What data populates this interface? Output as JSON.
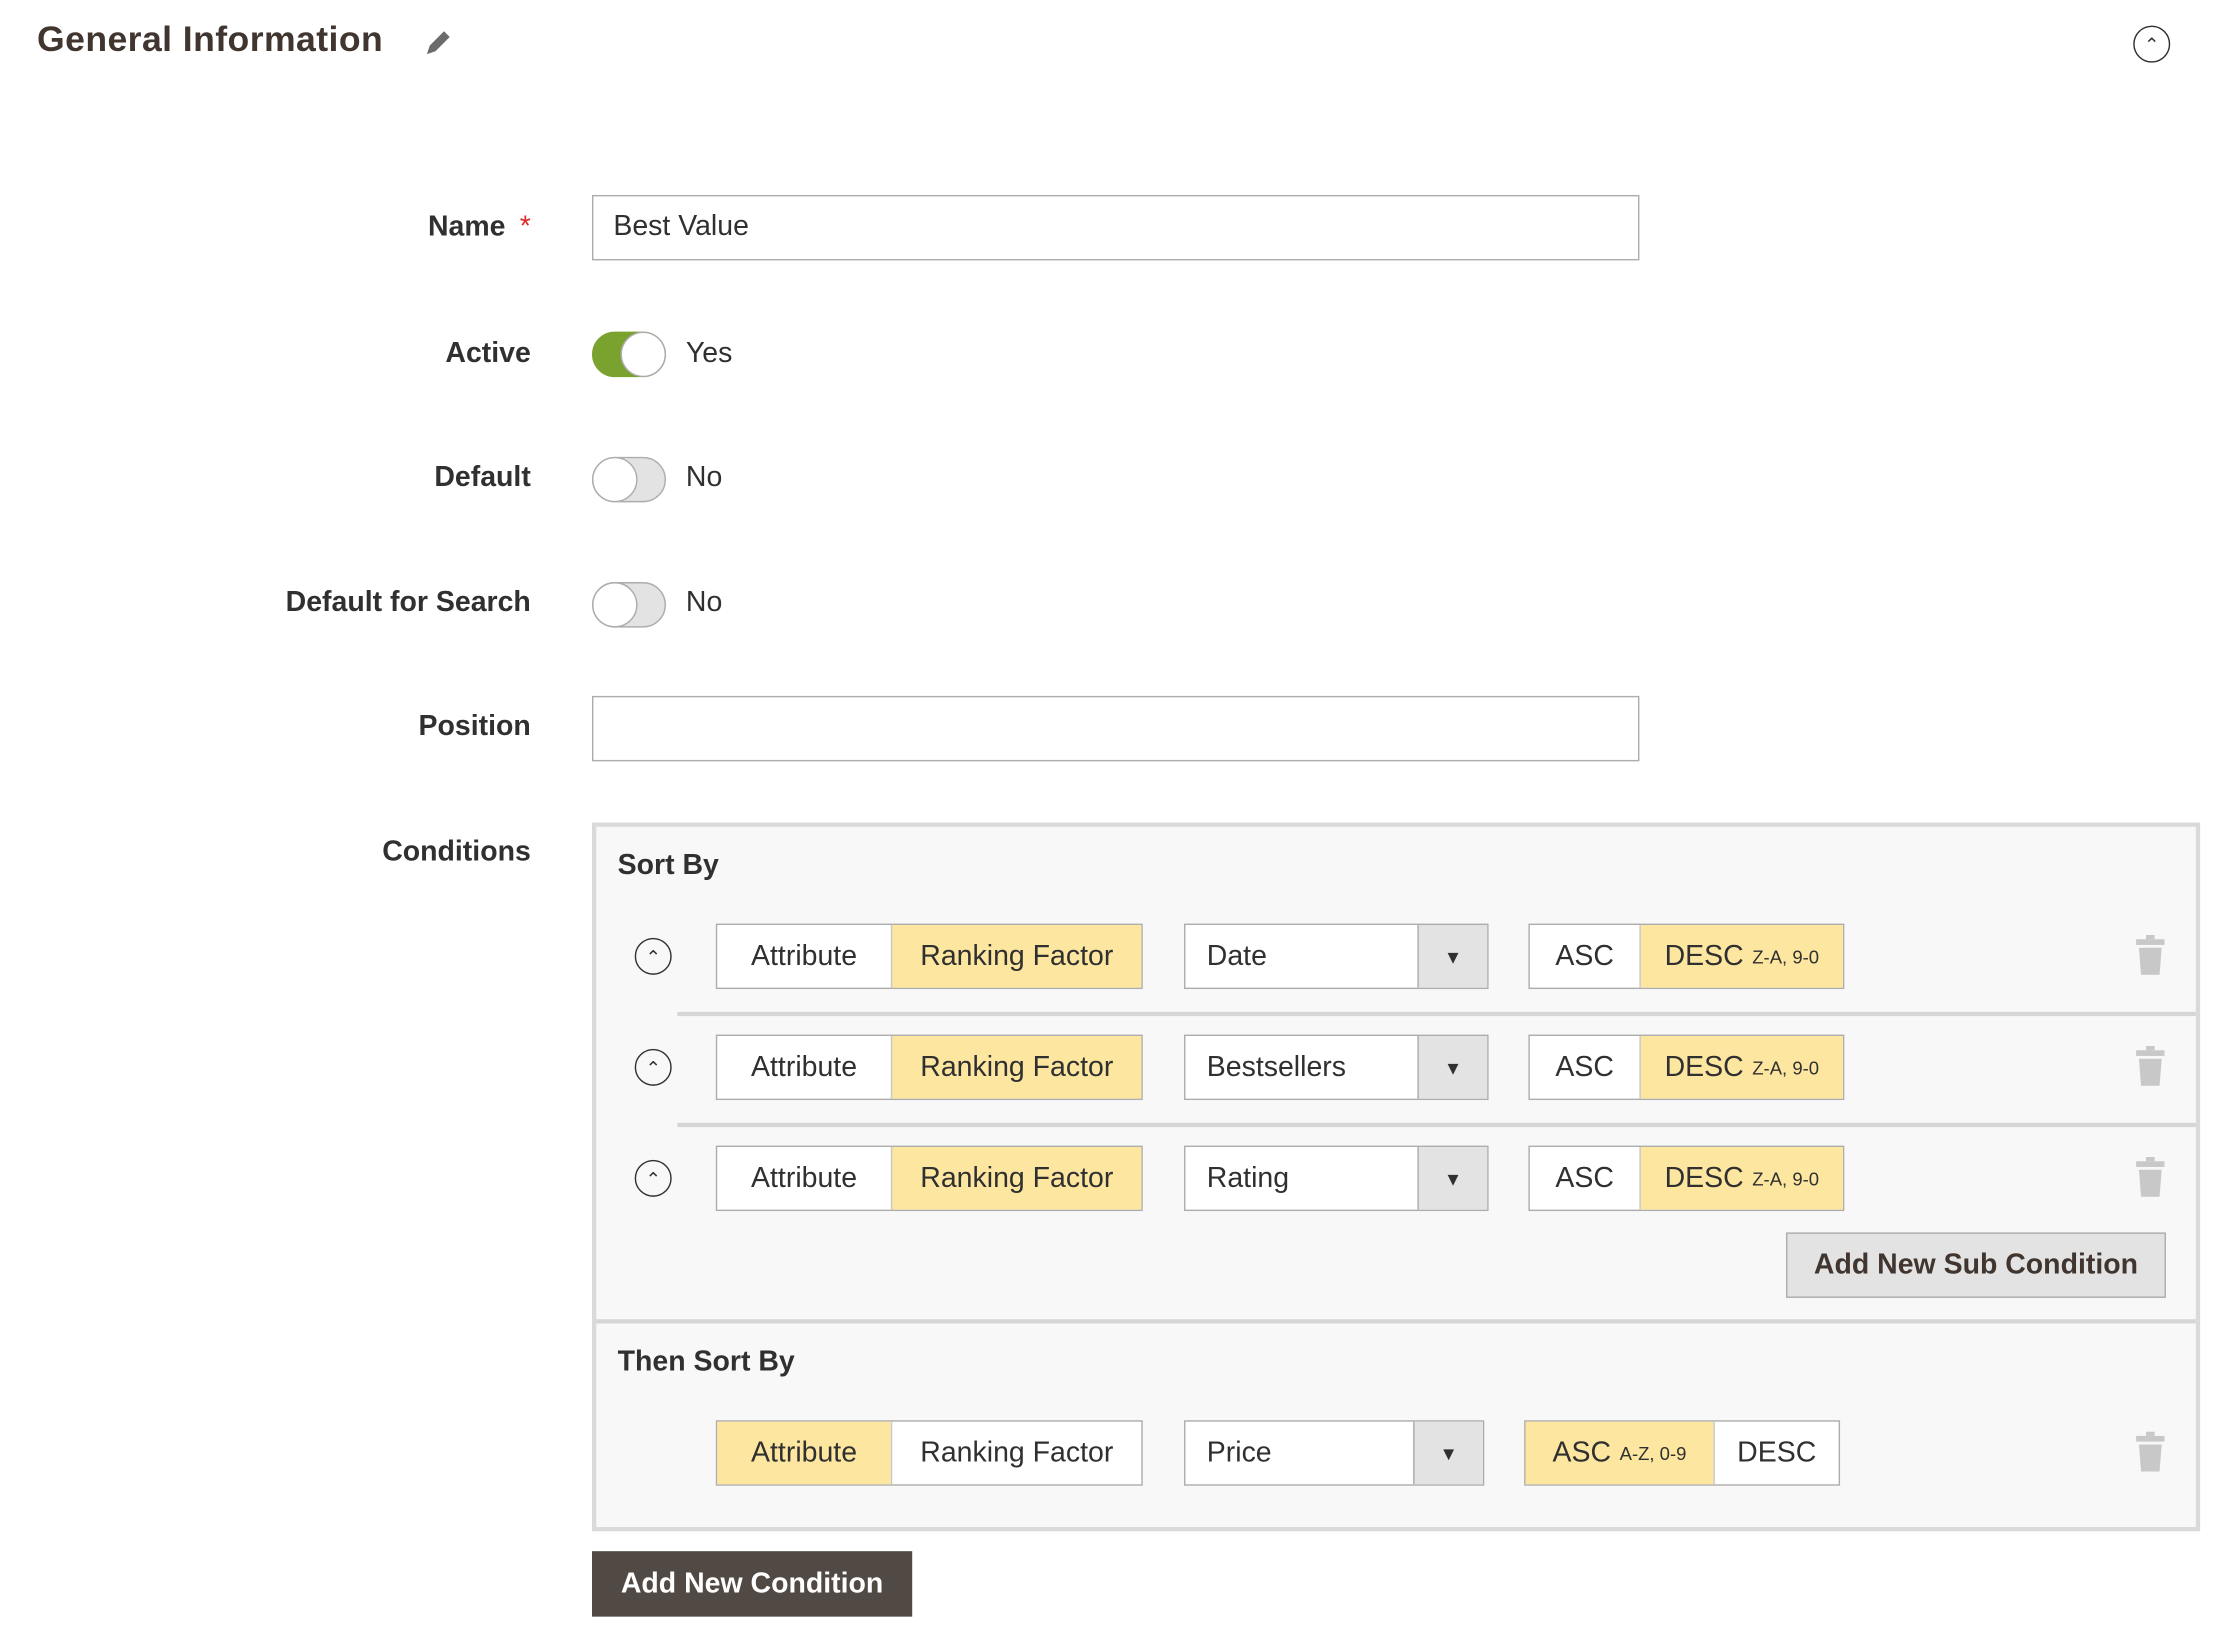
{
  "header": {
    "title": "General Information",
    "edit_icon": "pencil-icon",
    "collapse_icon": "chevron-up-circle-icon"
  },
  "form": {
    "name": {
      "label": "Name",
      "required_mark": "*",
      "value": "Best Value"
    },
    "active": {
      "label": "Active",
      "state": true,
      "text": "Yes"
    },
    "default": {
      "label": "Default",
      "state": false,
      "text": "No"
    },
    "default_search": {
      "label": "Default for Search",
      "state": false,
      "text": "No"
    },
    "position": {
      "label": "Position",
      "value": ""
    },
    "conditions_label": "Conditions"
  },
  "conditions": {
    "sort_by": {
      "title": "Sort By",
      "rows": [
        {
          "type_options": [
            "Attribute",
            "Ranking Factor"
          ],
          "type_selected": "Ranking Factor",
          "value": "Date",
          "asc": "ASC",
          "desc": "DESC",
          "hint": "Z-A, 9-0",
          "order": "DESC"
        },
        {
          "type_options": [
            "Attribute",
            "Ranking Factor"
          ],
          "type_selected": "Ranking Factor",
          "value": "Bestsellers",
          "asc": "ASC",
          "desc": "DESC",
          "hint": "Z-A, 9-0",
          "order": "DESC"
        },
        {
          "type_options": [
            "Attribute",
            "Ranking Factor"
          ],
          "type_selected": "Ranking Factor",
          "value": "Rating",
          "asc": "ASC",
          "desc": "DESC",
          "hint": "Z-A, 9-0",
          "order": "DESC"
        }
      ],
      "add_sub_label": "Add New Sub Condition"
    },
    "then_sort_by": {
      "title": "Then Sort By",
      "row": {
        "type_options": [
          "Attribute",
          "Ranking Factor"
        ],
        "type_selected": "Attribute",
        "value": "Price",
        "asc": "ASC",
        "hint": "A-Z, 0-9",
        "desc": "DESC",
        "order": "ASC"
      }
    },
    "add_condition_label": "Add New Condition"
  },
  "colors": {
    "selected": "#fde7a0",
    "toggle_on": "#79a22e",
    "primary_button": "#514943"
  }
}
